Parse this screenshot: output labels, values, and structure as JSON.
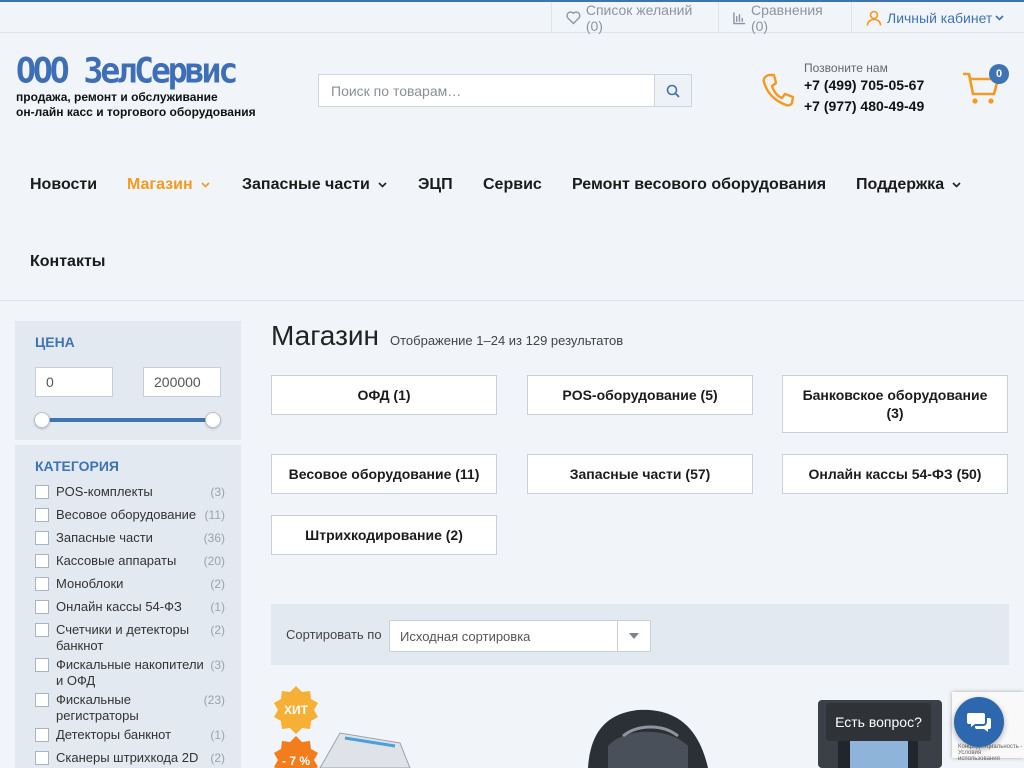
{
  "topbar": {
    "wishlist": "Список желаний (0)",
    "compare": "Сравнения (0)",
    "account": "Личный кабинет"
  },
  "logo": {
    "title": "ООО ЗелСервис",
    "subtitle_1": "продажа, ремонт и обслуживание",
    "subtitle_2": "он-лайн касс и торгового оборудования"
  },
  "search": {
    "placeholder": "Поиск по товарам…"
  },
  "contacts": {
    "caption": "Позвоните нам",
    "phone_1": "+7 (499) 705-05-67",
    "phone_2": "+7 (977) 480-49-49"
  },
  "cart": {
    "count": "0"
  },
  "nav": {
    "news": "Новости",
    "shop": "Магазин",
    "parts": "Запасные части",
    "ecp": "ЭЦП",
    "service": "Сервис",
    "scales_repair": "Ремонт весового оборудования",
    "support": "Поддержка",
    "contacts": "Контакты"
  },
  "sidebar": {
    "price_title": "ЦЕНА",
    "price_min": "0",
    "price_max": "200000",
    "category_title": "КАТЕГОРИЯ",
    "categories": [
      {
        "label": "POS-комплекты",
        "count": "(3)"
      },
      {
        "label": "Весовое оборудование",
        "count": "(11)"
      },
      {
        "label": "Запасные части",
        "count": "(36)"
      },
      {
        "label": "Кассовые аппараты",
        "count": "(20)"
      },
      {
        "label": "Моноблоки",
        "count": "(2)"
      },
      {
        "label": "Онлайн кассы 54-ФЗ",
        "count": "(1)"
      },
      {
        "label": "Счетчики и детекторы банкнот",
        "count": "(2)"
      },
      {
        "label": "Фискальные накопители и ОФД",
        "count": "(3)"
      },
      {
        "label": "Фискальные регистраторы",
        "count": "(23)"
      },
      {
        "label": "Детекторы банкнот",
        "count": "(1)"
      },
      {
        "label": "Сканеры штрихкода 2D",
        "count": "(2)"
      }
    ]
  },
  "main": {
    "title": "Магазин",
    "results": "Отображение 1–24 из 129 результатов",
    "category_buttons": [
      "ОФД (1)",
      "POS-оборудование (5)",
      "Банковское оборудование (3)",
      "Весовое оборудование (11)",
      "Запасные части (57)",
      "Онлайн кассы 54-ФЗ (50)",
      "Штрихкодирование (2)"
    ],
    "sort_label": "Сортировать по",
    "sort_value": "Исходная сортировка",
    "badge_hit": "ХИТ",
    "badge_discount": "- 7 %"
  },
  "chat": {
    "tooltip": "Есть вопрос?"
  },
  "recaptcha": {
    "text": "Конфиденциальность - Условия использования"
  },
  "colors": {
    "accent": "#3e74b4",
    "active": "#f39a1f",
    "background": "#f1f4f8",
    "panel": "#e3e9f1"
  }
}
